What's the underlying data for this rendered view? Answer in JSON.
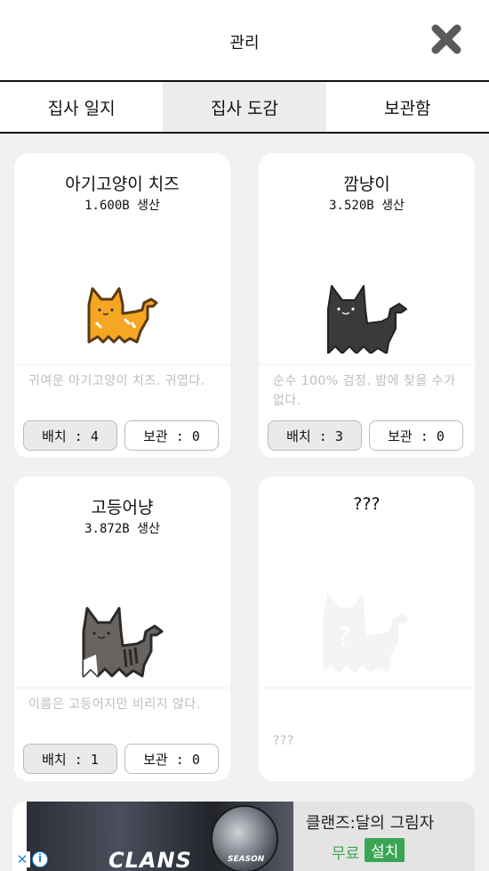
{
  "header": {
    "title": "관리"
  },
  "tabs": [
    {
      "label": "집사 일지",
      "active": false
    },
    {
      "label": "집사 도감",
      "active": true
    },
    {
      "label": "보관함",
      "active": false
    }
  ],
  "cards": [
    {
      "name": "아기고양이 치즈",
      "production": "1.600B 생산",
      "description": "귀여운 아기고양이 치즈. 귀엽다.",
      "deploy": "배치 : 4",
      "store": "보관 : 0",
      "cat": "orange-cat"
    },
    {
      "name": "깜냥이",
      "production": "3.520B 생산",
      "description": "순수 100% 검정. 밤에 찾을 수가 없다.",
      "deploy": "배치 : 3",
      "store": "보관 : 0",
      "cat": "black-cat"
    },
    {
      "name": "고등어냥",
      "production": "3.872B 생산",
      "description": "이름은 고등어지만 비리지 않다.",
      "deploy": "배치 : 1",
      "store": "보관 : 0",
      "cat": "tabby-cat"
    },
    {
      "name": "???",
      "description": "???",
      "cat": "unknown-cat"
    }
  ],
  "ad": {
    "app_name": "클랜즈:달의 그림자",
    "price": "무료",
    "install_label": "설치",
    "banner_title": "CLANS",
    "icon_label": "SEASON"
  },
  "colors": {
    "install_green": "#3aa655",
    "active_tab_bg": "#ececec",
    "content_bg": "#f1f1f1"
  }
}
